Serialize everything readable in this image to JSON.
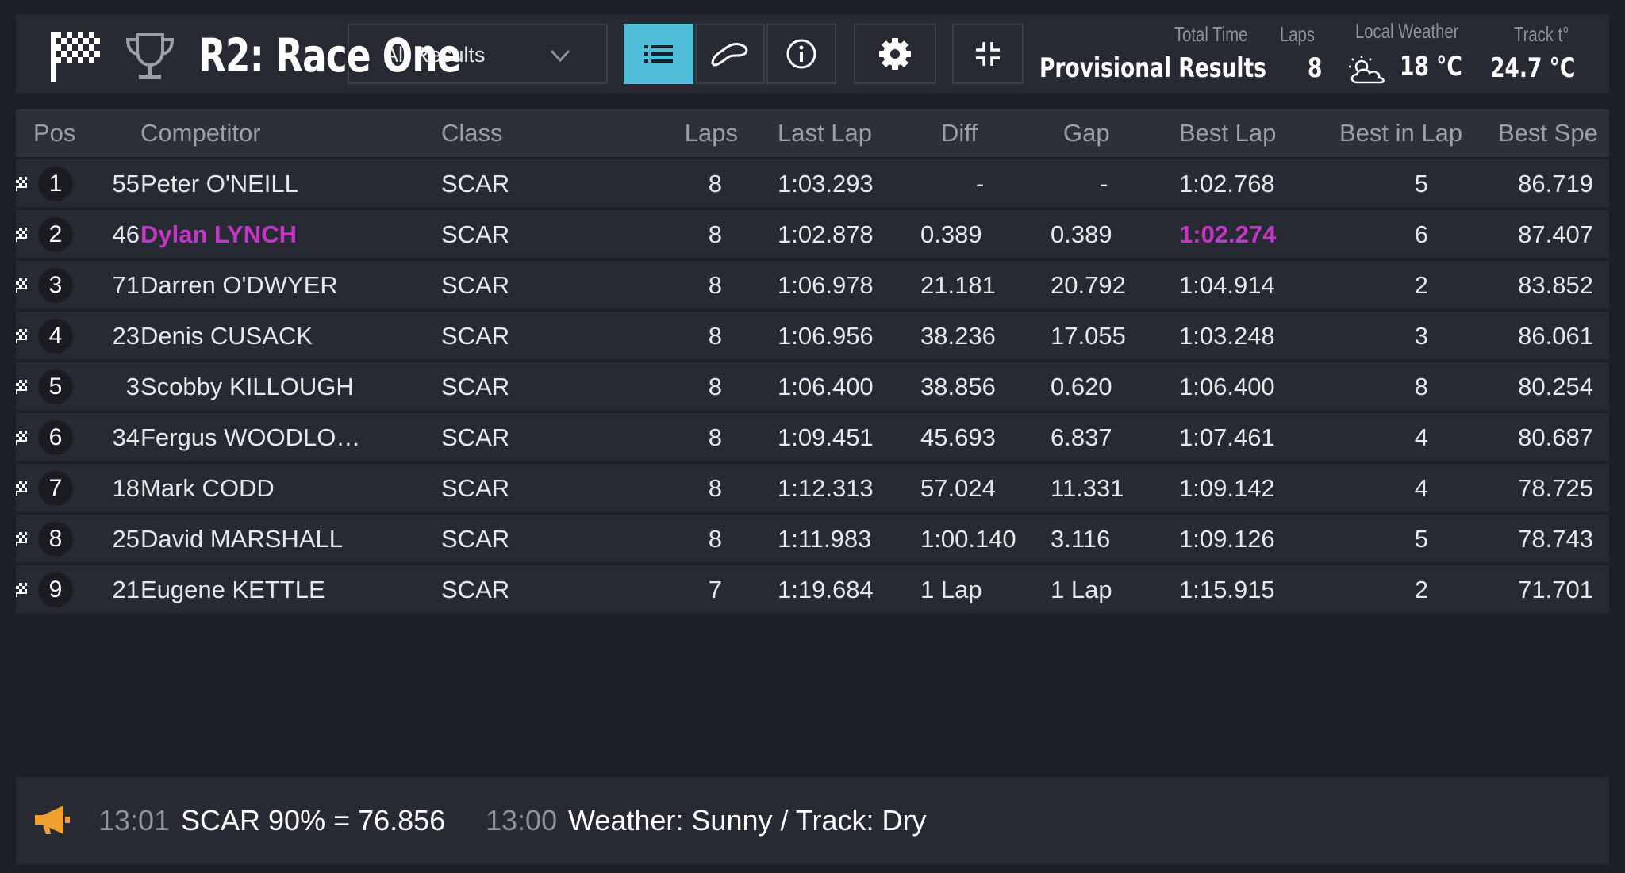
{
  "header": {
    "race_title": "R2: Race One",
    "dropdown_label": "All Results",
    "total_time_label": "Total Time",
    "total_time_value": "Provisional Results",
    "laps_label": "Laps",
    "laps_value": "8",
    "weather_label": "Local Weather",
    "weather_value": "18 °C",
    "track_label": "Track t°",
    "track_value": "24.7 °C",
    "active_view": "list",
    "accent_color": "#4fbcd8"
  },
  "table": {
    "columns": {
      "pos": "Pos",
      "competitor": "Competitor",
      "class": "Class",
      "laps": "Laps",
      "last_lap": "Last Lap",
      "diff": "Diff",
      "gap": "Gap",
      "best_lap": "Best Lap",
      "best_in_lap": "Best in Lap",
      "best_speed": "Best Spe"
    },
    "highlight_color": "#c535c8",
    "rows": [
      {
        "pos": "1",
        "num": "55",
        "name": "Peter O'NEILL",
        "class": "SCAR",
        "laps": "8",
        "last_lap": "1:03.293",
        "diff": "-",
        "gap": "-",
        "best_lap": "1:02.768",
        "best_in_lap": "5",
        "best_speed": "86.719"
      },
      {
        "pos": "2",
        "num": "46",
        "name": "Dylan LYNCH",
        "class": "SCAR",
        "laps": "8",
        "last_lap": "1:02.878",
        "diff": "0.389",
        "gap": "0.389",
        "best_lap": "1:02.274",
        "best_in_lap": "6",
        "best_speed": "87.407"
      },
      {
        "pos": "3",
        "num": "71",
        "name": "Darren O'DWYER",
        "class": "SCAR",
        "laps": "8",
        "last_lap": "1:06.978",
        "diff": "21.181",
        "gap": "20.792",
        "best_lap": "1:04.914",
        "best_in_lap": "2",
        "best_speed": "83.852"
      },
      {
        "pos": "4",
        "num": "23",
        "name": "Denis CUSACK",
        "class": "SCAR",
        "laps": "8",
        "last_lap": "1:06.956",
        "diff": "38.236",
        "gap": "17.055",
        "best_lap": "1:03.248",
        "best_in_lap": "3",
        "best_speed": "86.061"
      },
      {
        "pos": "5",
        "num": "3",
        "name": "Scobby KILLOUGH",
        "class": "SCAR",
        "laps": "8",
        "last_lap": "1:06.400",
        "diff": "38.856",
        "gap": "0.620",
        "best_lap": "1:06.400",
        "best_in_lap": "8",
        "best_speed": "80.254"
      },
      {
        "pos": "6",
        "num": "34",
        "name": "Fergus WOODLO…",
        "class": "SCAR",
        "laps": "8",
        "last_lap": "1:09.451",
        "diff": "45.693",
        "gap": "6.837",
        "best_lap": "1:07.461",
        "best_in_lap": "4",
        "best_speed": "80.687"
      },
      {
        "pos": "7",
        "num": "18",
        "name": "Mark CODD",
        "class": "SCAR",
        "laps": "8",
        "last_lap": "1:12.313",
        "diff": "57.024",
        "gap": "11.331",
        "best_lap": "1:09.142",
        "best_in_lap": "4",
        "best_speed": "78.725"
      },
      {
        "pos": "8",
        "num": "25",
        "name": "David MARSHALL",
        "class": "SCAR",
        "laps": "8",
        "last_lap": "1:11.983",
        "diff": "1:00.140",
        "gap": "3.116",
        "best_lap": "1:09.126",
        "best_in_lap": "5",
        "best_speed": "78.743"
      },
      {
        "pos": "9",
        "num": "21",
        "name": "Eugene KETTLE",
        "class": "SCAR",
        "laps": "7",
        "last_lap": "1:19.684",
        "diff": "1 Lap",
        "gap": "1 Lap",
        "best_lap": "1:15.915",
        "best_in_lap": "2",
        "best_speed": "71.701"
      }
    ]
  },
  "ticker": {
    "icon": "megaphone-icon",
    "icon_color": "#f0a030",
    "messages": [
      {
        "time": "13:01",
        "text": "SCAR 90% = 76.856"
      },
      {
        "time": "13:00",
        "text": "Weather: Sunny / Track: Dry"
      }
    ]
  }
}
